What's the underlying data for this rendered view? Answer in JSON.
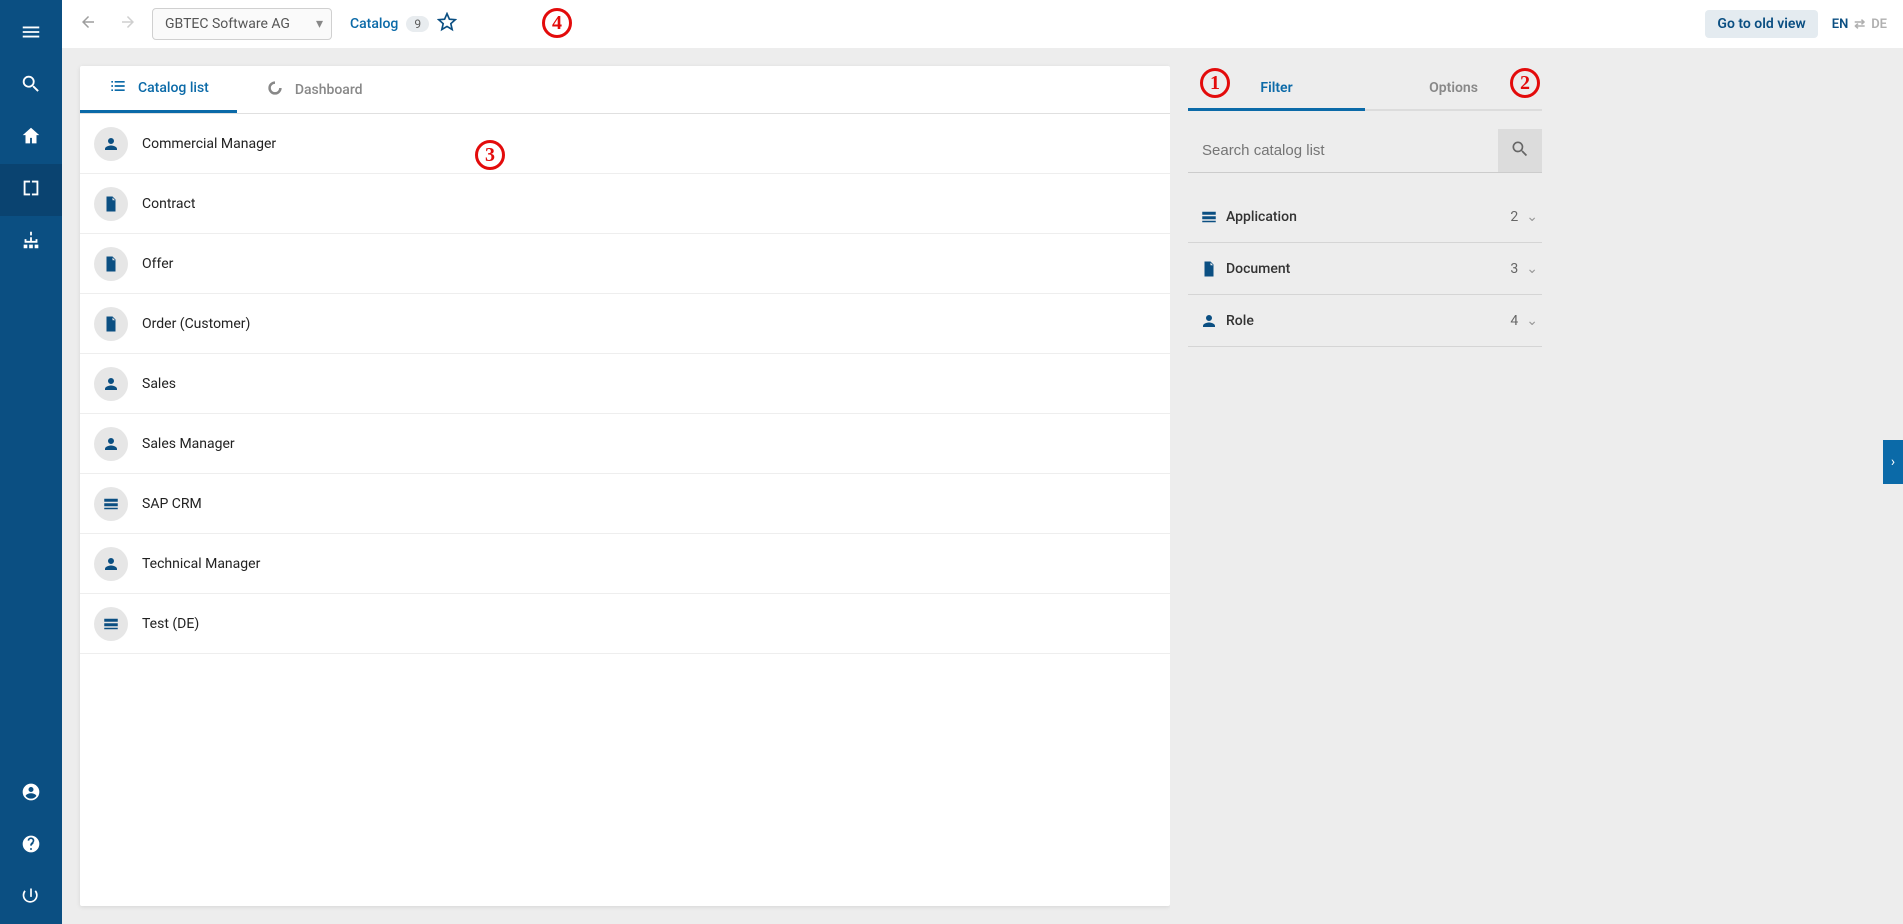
{
  "topbar": {
    "repo_name": "GBTEC Software AG",
    "breadcrumb_label": "Catalog",
    "breadcrumb_count": "9",
    "old_view_label": "Go to old view",
    "lang_active": "EN",
    "lang_inactive": "DE"
  },
  "tabs": {
    "catalog_list": "Catalog list",
    "dashboard": "Dashboard"
  },
  "catalog_items": [
    {
      "label": "Commercial Manager",
      "icon": "person"
    },
    {
      "label": "Contract",
      "icon": "document"
    },
    {
      "label": "Offer",
      "icon": "document"
    },
    {
      "label": "Order (Customer)",
      "icon": "document"
    },
    {
      "label": "Sales",
      "icon": "person"
    },
    {
      "label": "Sales Manager",
      "icon": "person"
    },
    {
      "label": "SAP CRM",
      "icon": "application"
    },
    {
      "label": "Technical Manager",
      "icon": "person"
    },
    {
      "label": "Test (DE)",
      "icon": "application"
    }
  ],
  "right_panel": {
    "tab_filter": "Filter",
    "tab_options": "Options",
    "search_placeholder": "Search catalog list",
    "filters": [
      {
        "label": "Application",
        "count": "2",
        "icon": "application"
      },
      {
        "label": "Document",
        "count": "3",
        "icon": "document"
      },
      {
        "label": "Role",
        "count": "4",
        "icon": "person"
      }
    ]
  },
  "annotations": {
    "a1": "1",
    "a2": "2",
    "a3": "3",
    "a4": "4"
  }
}
